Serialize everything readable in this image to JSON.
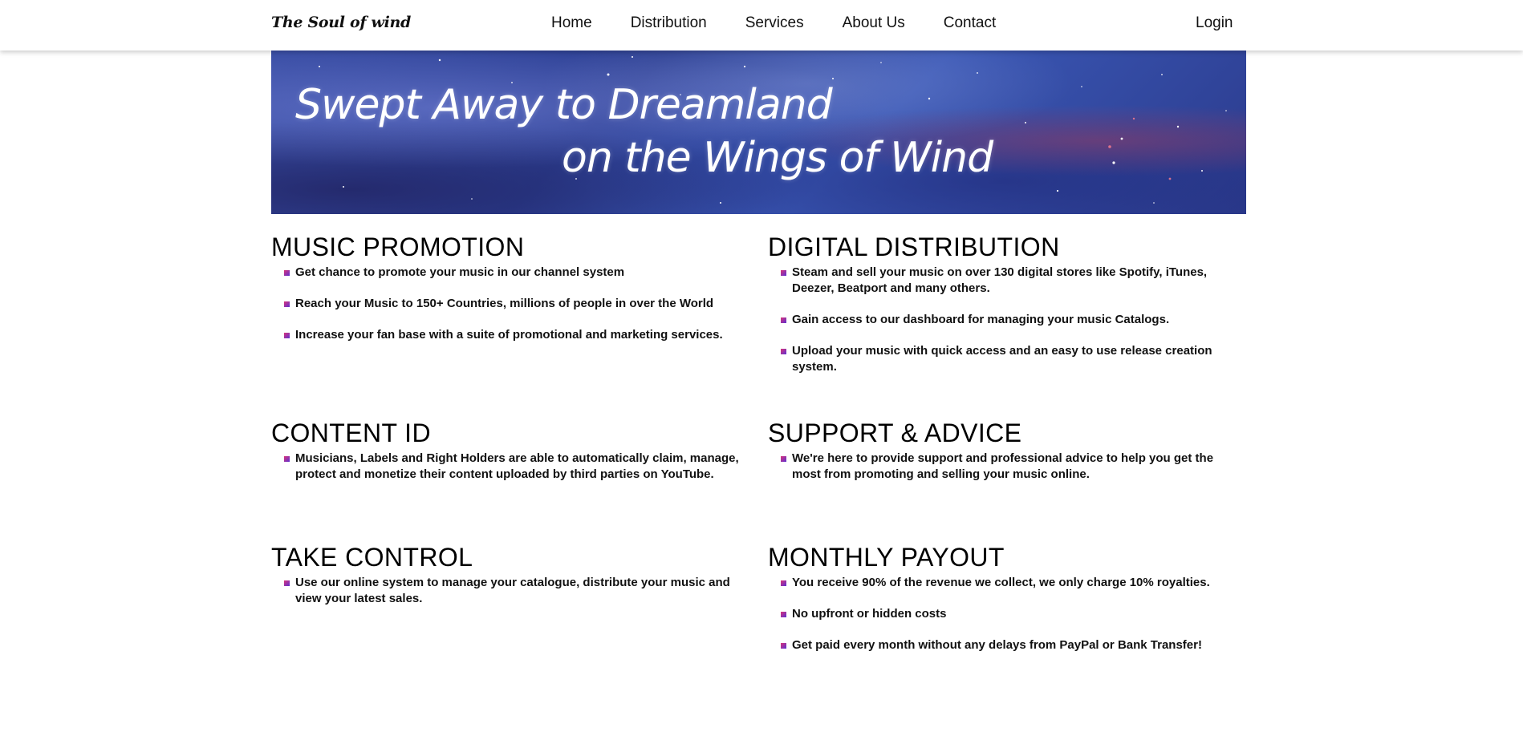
{
  "header": {
    "logo": "The Soul of wind",
    "nav": [
      "Home",
      "Distribution",
      "Services",
      "About Us",
      "Contact"
    ],
    "login": "Login"
  },
  "banner": {
    "line1": "Swept Away to Dreamland",
    "line2": "on the Wings of Wind"
  },
  "sections": [
    {
      "title": "MUSIC PROMOTION",
      "items": [
        "Get chance to promote your music in our channel system",
        "Reach your Music to 150+ Countries, millions of people in over the World",
        "Increase your fan base with a suite of promotional and marketing services."
      ]
    },
    {
      "title": "DIGITAL DISTRIBUTION",
      "items": [
        "Steam and sell your music on over 130 digital stores like Spotify, iTunes, Deezer, Beatport and many others.",
        "Gain access to our dashboard for managing your music Catalogs.",
        "Upload your music with quick access and an easy to use release creation system."
      ]
    },
    {
      "title": "CONTENT ID",
      "items": [
        "Musicians, Labels and Right Holders are able to automatically claim, manage, protect and monetize their content uploaded by third parties on YouTube."
      ]
    },
    {
      "title": "SUPPORT & ADVICE",
      "items": [
        "We're here to provide support and professional advice to help you get the most from promoting and selling your music online."
      ]
    },
    {
      "title": "TAKE CONTROL",
      "items": [
        "Use our online system to manage your catalogue, distribute your music and view your latest sales."
      ]
    },
    {
      "title": "MONTHLY PAYOUT",
      "items": [
        "You receive 90% of the revenue we collect, we only charge 10% royalties.",
        "No upfront or hidden costs",
        "Get paid every month without any delays from PayPal or Bank Transfer!"
      ]
    }
  ],
  "colors": {
    "bullet_start": "#d9347a",
    "bullet_end": "#5d2fd1",
    "banner_base": "#2c3f93"
  }
}
